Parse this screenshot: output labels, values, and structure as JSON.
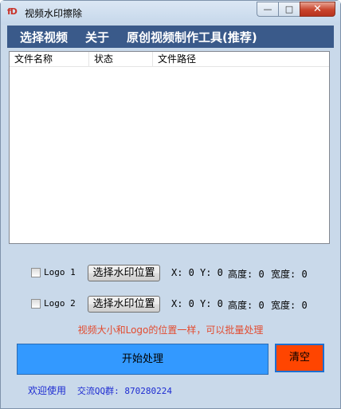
{
  "window": {
    "title": "视频水印擦除",
    "app_icon_text": "fD"
  },
  "menu": [
    "选择视频",
    "关于",
    "原创视频制作工具(推荐)"
  ],
  "list": {
    "columns": [
      "文件名称",
      "状态",
      "文件路径"
    ],
    "rows": []
  },
  "logo_rows": [
    {
      "label": "Logo 1",
      "checked": false,
      "button": "选择水印位置",
      "x": "X: 0",
      "y": "Y: 0",
      "height": "高度: 0",
      "width": "宽度: 0"
    },
    {
      "label": "Logo 2",
      "checked": false,
      "button": "选择水印位置",
      "x": "X: 0",
      "y": "Y: 0",
      "height": "高度: 0",
      "width": "宽度: 0"
    }
  ],
  "hint": "视频大小和Logo的位置一样，可以批量处理",
  "actions": {
    "start": "开始处理",
    "clear": "清空"
  },
  "footer": {
    "welcome": "欢迎使用",
    "qq": "交流QQ群: 870280224"
  },
  "colors": {
    "menubar": "#3a5a8a",
    "start_button": "#3399ff",
    "clear_button": "#ff4500",
    "hint": "#e34b2f",
    "footer": "#1d2bd1"
  }
}
